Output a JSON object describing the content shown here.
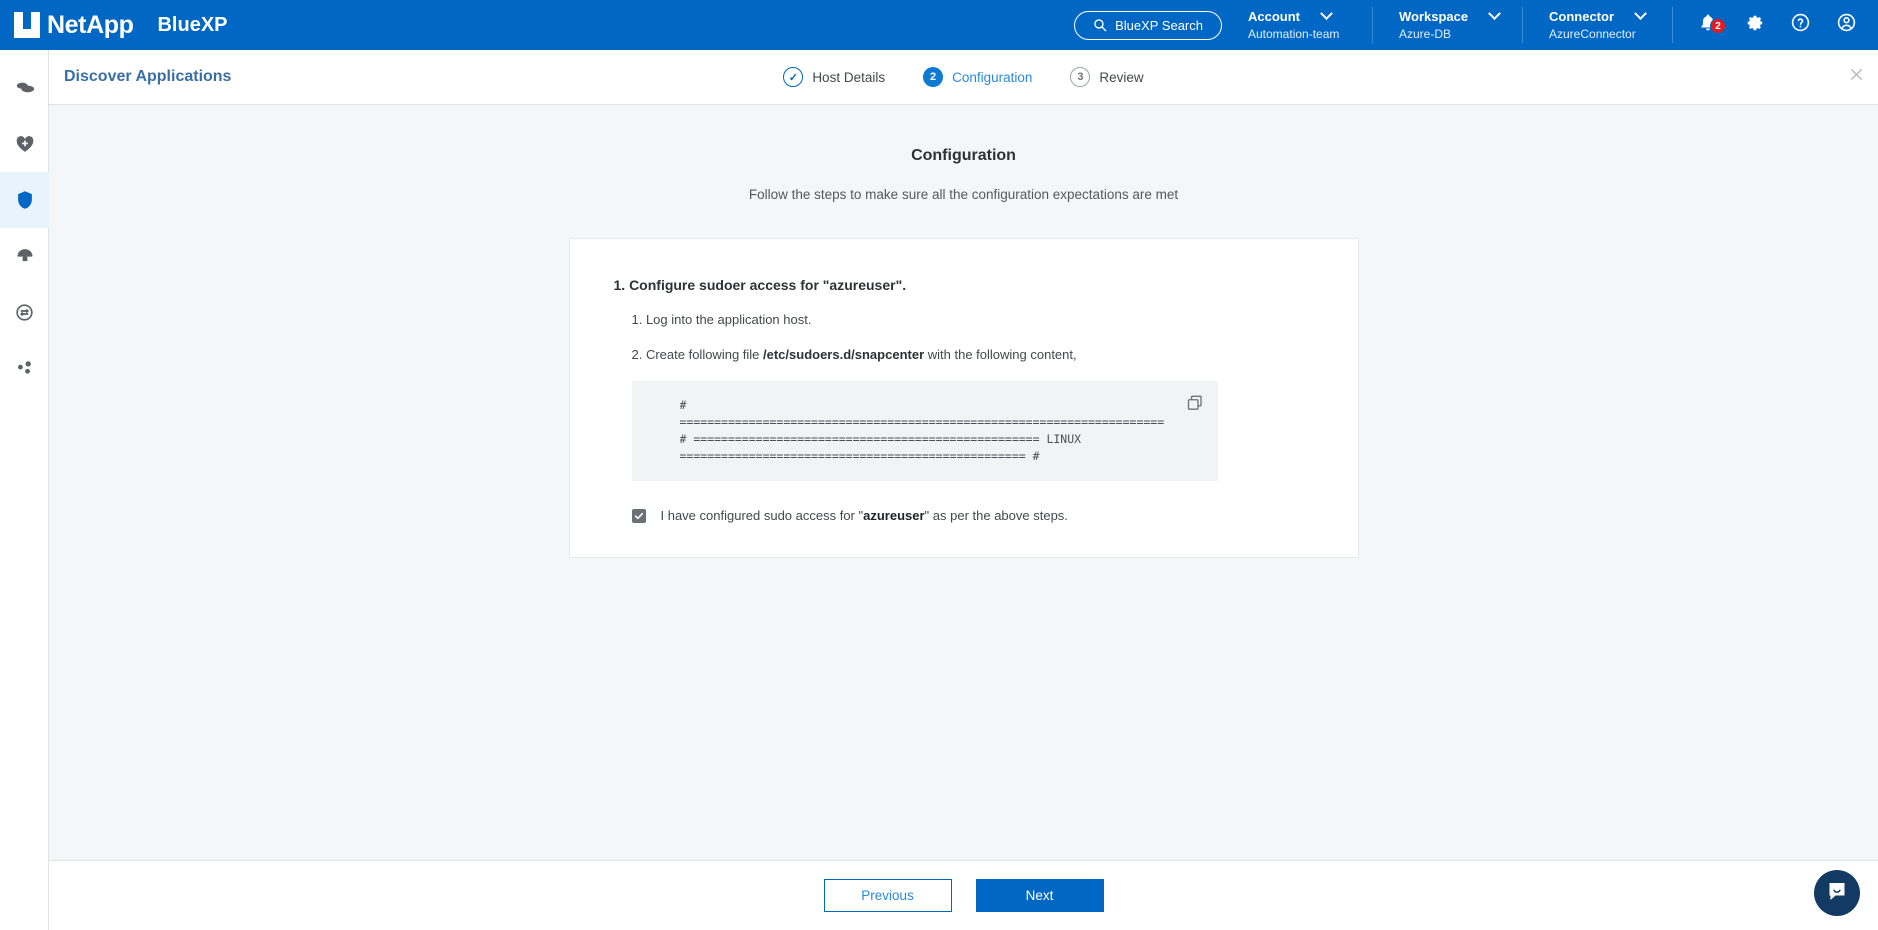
{
  "topbar": {
    "brand": "NetApp",
    "product": "BlueXP",
    "search_label": "BlueXP Search",
    "contexts": [
      {
        "label": "Account",
        "value": "Automation-team"
      },
      {
        "label": "Workspace",
        "value": "Azure-DB"
      },
      {
        "label": "Connector",
        "value": "AzureConnector"
      }
    ],
    "notification_count": "2",
    "icons": [
      "bell-icon",
      "gear-icon",
      "help-icon",
      "user-icon"
    ]
  },
  "sidebar": {
    "items": [
      {
        "name": "canvas-icon",
        "active": false
      },
      {
        "name": "health-icon",
        "active": false
      },
      {
        "name": "protection-shield-icon",
        "active": true
      },
      {
        "name": "governance-icon",
        "active": false
      },
      {
        "name": "mobility-icon",
        "active": false
      },
      {
        "name": "extensions-icon",
        "active": false
      }
    ]
  },
  "page": {
    "title": "Discover Applications",
    "close_label": "×",
    "steps": [
      {
        "marker": "✓",
        "label": "Host Details",
        "state": "done"
      },
      {
        "marker": "2",
        "label": "Configuration",
        "state": "active"
      },
      {
        "marker": "3",
        "label": "Review",
        "state": "todo"
      }
    ]
  },
  "main": {
    "heading": "Configuration",
    "subheading": "Follow the steps to make sure all the configuration expectations are met",
    "step_one_title": "1. Configure sudoer access for \"azureuser\".",
    "substeps": {
      "one": "1. Log into the application host.",
      "two_prefix": "2. Create following file ",
      "two_path": "/etc/sudoers.d/snapcenter",
      "two_suffix": " with the following content,"
    },
    "code": "#\n======================================================================\n# ================================================== LINUX\n================================================== #",
    "copy_icon": "copy-icon",
    "checkbox": {
      "checked": true,
      "prefix": "I have configured sudo access for \"",
      "user": "azureuser",
      "suffix": "\" as per the above steps."
    }
  },
  "footer": {
    "previous_label": "Previous",
    "next_label": "Next"
  },
  "chat": {
    "icon": "chat-bubble-icon"
  },
  "colors": {
    "brand_blue": "#0067c5",
    "active_blue": "#0e7ad4",
    "badge_red": "#e31b23",
    "content_bg": "#f5f6f7",
    "chat_navy": "#123a63"
  }
}
